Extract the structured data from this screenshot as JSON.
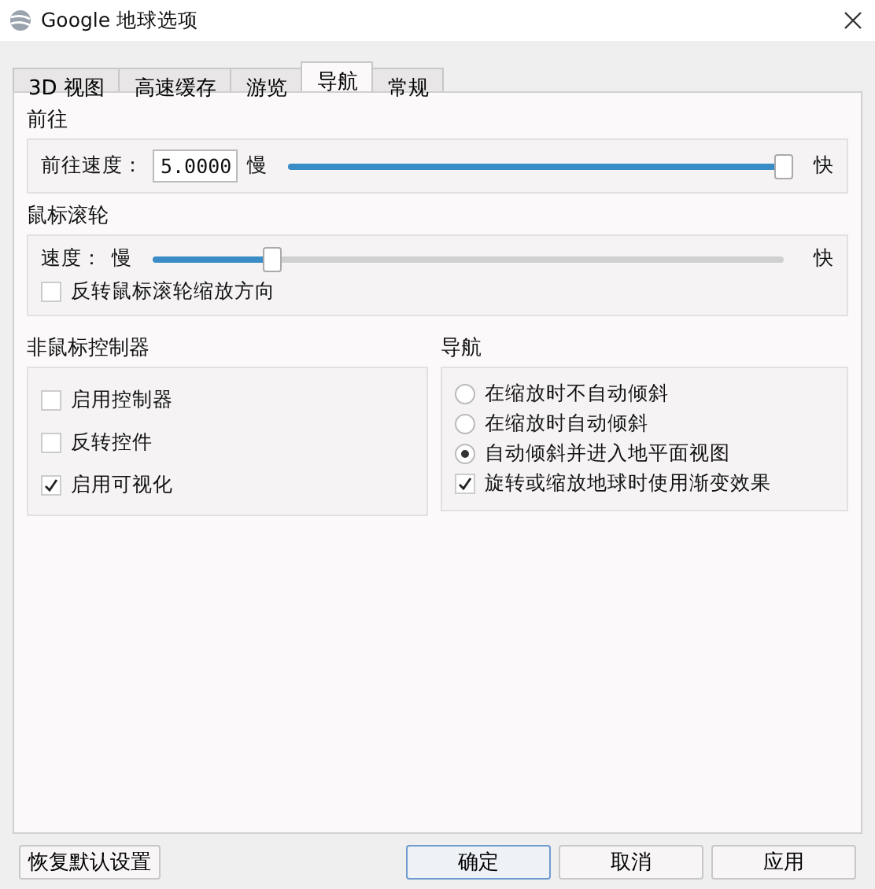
{
  "window": {
    "title": "Google 地球选项"
  },
  "tabs": [
    {
      "label": "3D 视图",
      "selected": false
    },
    {
      "label": "高速缓存",
      "selected": false
    },
    {
      "label": "游览",
      "selected": false
    },
    {
      "label": "导航",
      "selected": true
    },
    {
      "label": "常规",
      "selected": false
    }
  ],
  "fly_to": {
    "title": "前往",
    "speed_label": "前往速度：",
    "speed_value": "5.0000",
    "slow": "慢",
    "fast": "快",
    "level": 1.0
  },
  "mouse_wheel": {
    "title": "鼠标滚轮",
    "speed_label": "速度：",
    "slow": "慢",
    "fast": "快",
    "level": 0.19,
    "invert": {
      "label": "反转鼠标滚轮缩放方向",
      "checked": false
    }
  },
  "non_mouse_controller": {
    "title": "非鼠标控制器",
    "options": [
      {
        "label": "启用控制器",
        "checked": false
      },
      {
        "label": "反转控件",
        "checked": false
      },
      {
        "label": "启用可视化",
        "checked": true
      }
    ]
  },
  "navigation": {
    "title": "导航",
    "radios": [
      {
        "label": "在缩放时不自动倾斜",
        "selected": false
      },
      {
        "label": "在缩放时自动倾斜",
        "selected": false
      },
      {
        "label": "自动倾斜并进入地平面视图",
        "selected": true
      }
    ],
    "fade": {
      "label": "旋转或缩放地球时使用渐变效果",
      "checked": true
    }
  },
  "buttons": {
    "restore": "恢复默认设置",
    "actions": [
      {
        "label": "确定",
        "default": true
      },
      {
        "label": "取消",
        "default": false
      },
      {
        "label": "应用",
        "default": false
      }
    ]
  }
}
